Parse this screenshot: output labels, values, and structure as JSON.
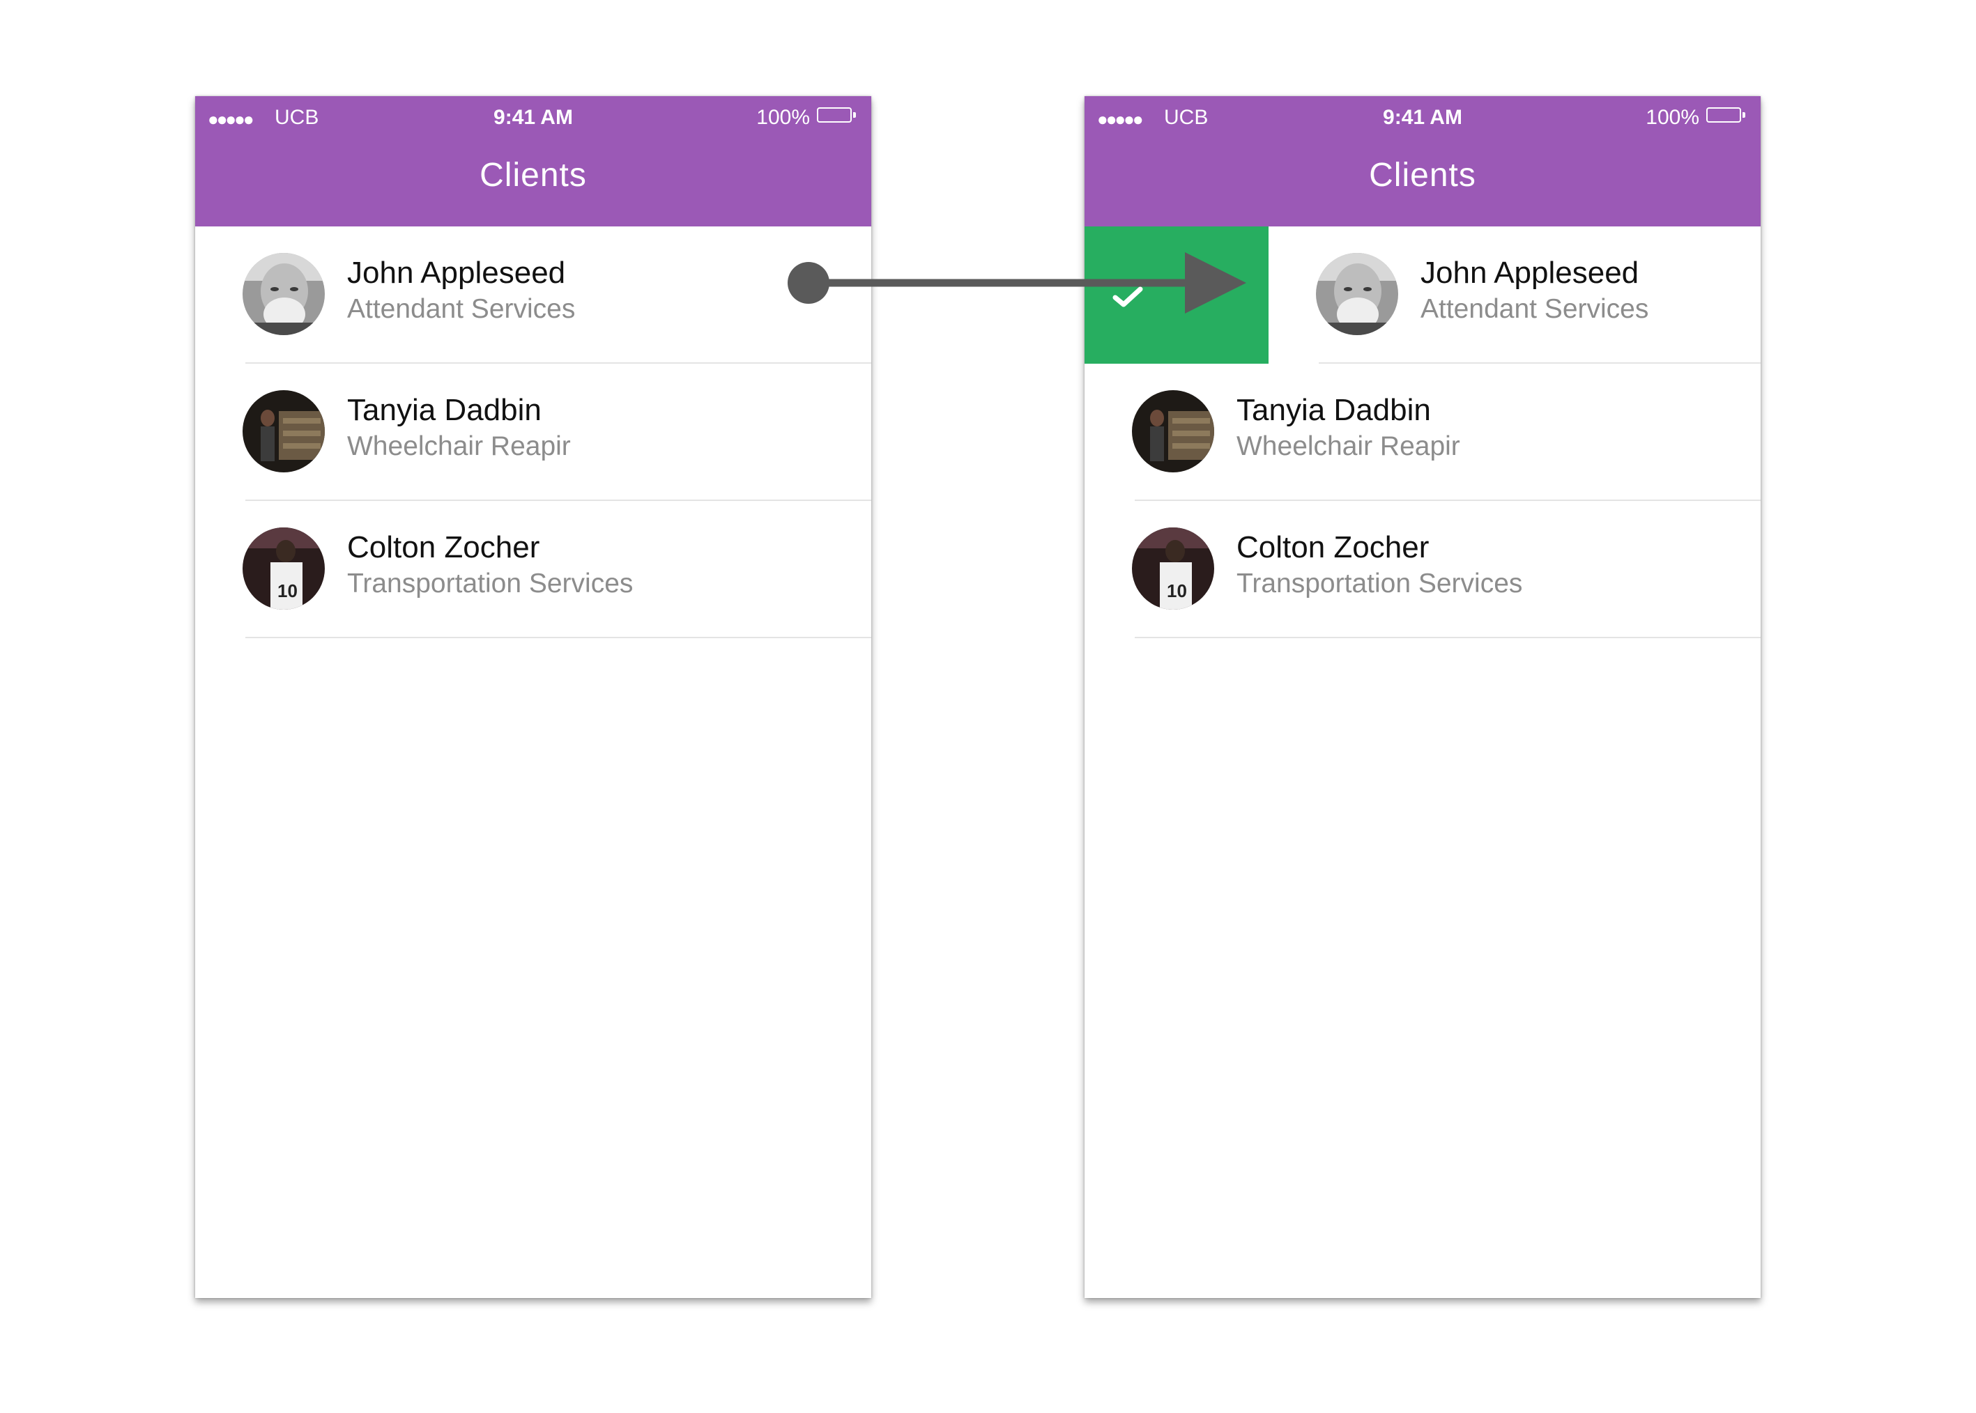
{
  "status_bar": {
    "signal": "●●●●●",
    "carrier": "UCB",
    "time": "9:41 AM",
    "battery": "100%",
    "battery_level": 1.0
  },
  "header": {
    "title": "Clients"
  },
  "clients": [
    {
      "name": "John Appleseed",
      "service": "Attendant Services"
    },
    {
      "name": "Tanyia Dadbin",
      "service": "Wheelchair Reapir"
    },
    {
      "name": "Colton Zocher",
      "service": "Transportation Services"
    }
  ],
  "colors": {
    "header": "#9b59b6",
    "swipe_action": "#27ae60",
    "gesture_arrow": "#5a5a5a",
    "service_text": "#8c8c8c"
  },
  "icons": {
    "swipe_action_icon": "check-icon",
    "gesture": "swipe-right-arrow"
  }
}
